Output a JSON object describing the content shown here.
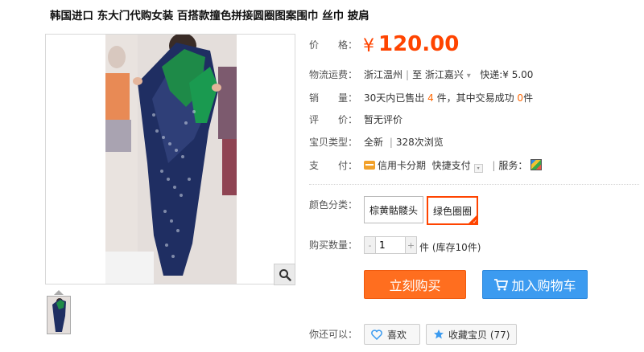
{
  "product": {
    "title": "韩国进口 东大门代购女装 百搭款撞色拼接圆圈图案围巾 丝巾 披肩"
  },
  "price": {
    "label": "价　　格：",
    "currency": "¥",
    "value": "120.00"
  },
  "shipping": {
    "label": "物流运费：",
    "from": "浙江温州",
    "to_prefix": "至",
    "to": "浙江嘉兴",
    "express": "快递:¥ 5.00"
  },
  "sales": {
    "label": "销　　量：",
    "prefix": "30天内已售出",
    "sold_count": "4",
    "middle": "件，其中交易成功",
    "success_count": "0",
    "suffix": "件"
  },
  "rating": {
    "label": "评　　价：",
    "text": "暂无评价"
  },
  "condition": {
    "label": "宝贝类型：",
    "type": "全新",
    "views": "328次浏览"
  },
  "payment": {
    "label": "支　　付：",
    "installment": "信用卡分期",
    "express_pay": "快捷支付",
    "service_label": "服务："
  },
  "options": {
    "label": "颜色分类：",
    "items": [
      {
        "label": "棕黄骷髅头"
      },
      {
        "label": "绿色圈圈"
      }
    ]
  },
  "quantity": {
    "label": "购买数量：",
    "minus": "-",
    "value": "1",
    "plus": "+",
    "suffix": "件 (库存10件)"
  },
  "actions": {
    "buy": "立刻购买",
    "cart": "加入购物车"
  },
  "extra": {
    "label": "你还可以：",
    "like": "喜欢",
    "favorite": "收藏宝贝 (77)"
  },
  "colors": {
    "price": "#ff4400",
    "buy_button": "#ff6e1f",
    "cart_button": "#3c9bf0"
  }
}
